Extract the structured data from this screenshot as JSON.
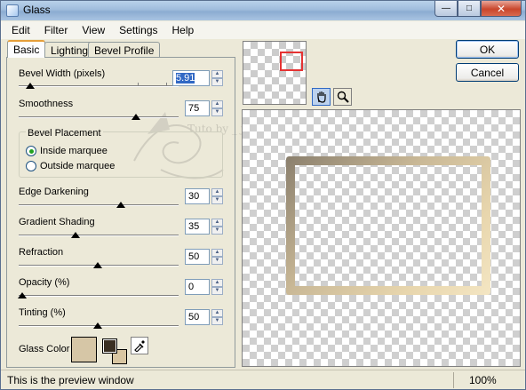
{
  "window": {
    "title": "Glass",
    "min_glyph": "—",
    "max_glyph": "□",
    "close_glyph": "✕"
  },
  "menu": [
    "Edit",
    "Filter",
    "View",
    "Settings",
    "Help"
  ],
  "tabs": [
    {
      "label": "Basic",
      "active": true
    },
    {
      "label": "Lighting",
      "active": false
    },
    {
      "label": "Bevel Profile",
      "active": false
    }
  ],
  "params": {
    "bevel_width": {
      "label": "Bevel Width (pixels)",
      "value": "5.91",
      "level": 0.05
    },
    "smoothness": {
      "label": "Smoothness",
      "value": "75",
      "level": 0.75
    },
    "edge_darkening": {
      "label": "Edge Darkening",
      "value": "30",
      "level": 0.65
    },
    "gradient_shading": {
      "label": "Gradient Shading",
      "value": "35",
      "level": 0.35
    },
    "refraction": {
      "label": "Refraction",
      "value": "50",
      "level": 0.5
    },
    "opacity": {
      "label": "Opacity (%)",
      "value": "0",
      "level": 0.0
    },
    "tinting": {
      "label": "Tinting (%)",
      "value": "50",
      "level": 0.5
    }
  },
  "bevel_placement": {
    "title": "Bevel Placement",
    "options": [
      {
        "label": "Inside marquee",
        "checked": true
      },
      {
        "label": "Outside marquee",
        "checked": false
      }
    ]
  },
  "glass_color": {
    "label": "Glass Color",
    "swatch": "#d6c6a6",
    "foreground": "#3a2f22",
    "background": "#d9c6a2"
  },
  "watermark": "Tuto by _ jensen Joyeux",
  "buttons": {
    "ok": "OK",
    "cancel": "Cancel"
  },
  "tools": {
    "hand_icon": "pan-hand-icon",
    "zoom_icon": "magnifier-icon"
  },
  "status": {
    "text": "This is the preview window",
    "zoom": "100%"
  }
}
